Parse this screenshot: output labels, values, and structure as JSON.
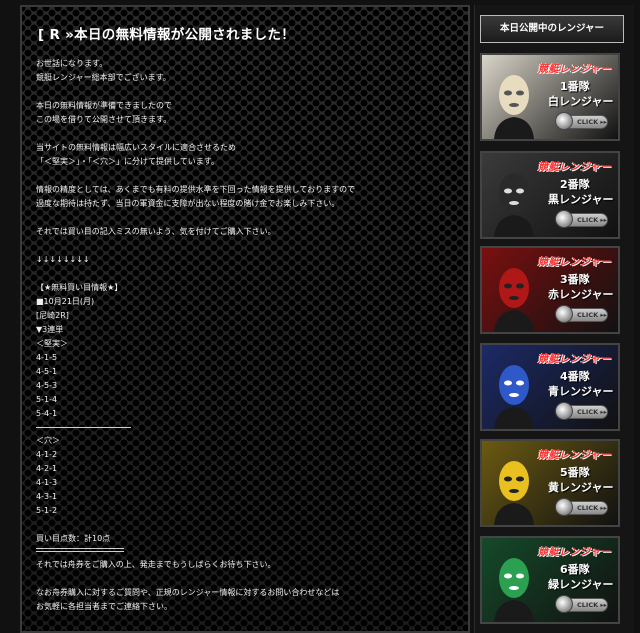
{
  "main": {
    "title": "[ R »本日の無料情報が公開されました！",
    "lines": [
      "お世話になります。",
      "競艇レンジャー総本部でございます。",
      "",
      "本日の無料情報が準備できましたので",
      "この場を借りて公開させて頂きます。",
      "",
      "当サイトの無料情報は幅広いスタイルに適合させるため",
      "「＜堅実＞」・「＜穴＞」に分けて提供しています。",
      "",
      "情報の精度としては、あくまでも有料の提供水準を下回った情報を提供しておりますので",
      "過度な期待は持たず、当日の軍資金に支障が出ない程度の賭け金でお楽しみ下さい。",
      "",
      "それでは買い目の記入ミスの無いよう、気を付けてご購入下さい。",
      "",
      "↓↓↓↓↓↓↓↓",
      "",
      "【★無料買い目情報★】",
      "■10月21日(月)",
      "[尼崎2R]",
      "▼3連単",
      "＜堅実＞",
      "4-1-5",
      "4-5-1",
      "4-5-3",
      "5-1-4",
      "5-4-1"
    ],
    "ana_label": "＜穴＞",
    "ana_lines": [
      "4-1-2",
      "4-2-1",
      "4-1-3",
      "4-3-1",
      "5-1-2"
    ],
    "total": "買い目点数：計10点",
    "footer_lines": [
      "それでは舟券をご購入の上、発走までもうしばらくお待ち下さい。",
      "",
      "なお舟券購入に対するご質問や、正規のレンジャー情報に対するお問い合わせなどは",
      "お気軽に各担当者までご連絡下さい。"
    ]
  },
  "sidebar": {
    "header": "本日公開中のレンジャー",
    "cards": [
      {
        "brand": "競艇レンジャー",
        "team": "1番隊",
        "name": "白レンジャー",
        "click": "CLICK",
        "bg": "#d9d4c8",
        "mask": "#e8dcc0",
        "eyes": "#555"
      },
      {
        "brand": "競艇レンジャー",
        "team": "2番隊",
        "name": "黒レンジャー",
        "click": "CLICK",
        "bg": "#3a3a3a",
        "mask": "#2a2a2a",
        "eyes": "#ddd"
      },
      {
        "brand": "競艇レンジャー",
        "team": "3番隊",
        "name": "赤レンジャー",
        "click": "CLICK",
        "bg": "#7a1010",
        "mask": "#b01818",
        "eyes": "#222"
      },
      {
        "brand": "競艇レンジャー",
        "team": "4番隊",
        "name": "青レンジャー",
        "click": "CLICK",
        "bg": "#1c2a66",
        "mask": "#2f58c8",
        "eyes": "#fff"
      },
      {
        "brand": "競艇レンジャー",
        "team": "5番隊",
        "name": "黄レンジャー",
        "click": "CLICK",
        "bg": "#6b5a12",
        "mask": "#e8c020",
        "eyes": "#222"
      },
      {
        "brand": "競艇レンジャー",
        "team": "6番隊",
        "name": "緑レンジャー",
        "click": "CLICK",
        "bg": "#154a2a",
        "mask": "#2aa050",
        "eyes": "#fff"
      }
    ]
  }
}
